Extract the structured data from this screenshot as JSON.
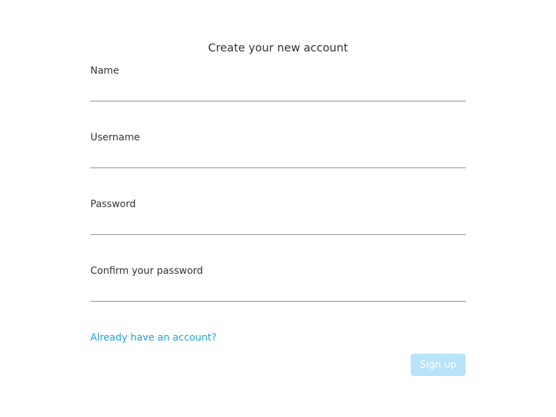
{
  "form": {
    "title": "Create your new account",
    "fields": [
      {
        "label": "Name",
        "value": "",
        "placeholder": ""
      },
      {
        "label": "Username",
        "value": "",
        "placeholder": ""
      },
      {
        "label": "Password",
        "value": "",
        "placeholder": ""
      },
      {
        "label": "Confirm your password",
        "value": "",
        "placeholder": ""
      }
    ],
    "signin_link": "Already have an account?",
    "signup_label": "Sign up",
    "colors": {
      "link": "#1aa3e0",
      "button_disabled_bg": "#b8e3f8",
      "button_text": "#ffffff",
      "text": "#333333",
      "underline": "#8a8a8a"
    }
  }
}
